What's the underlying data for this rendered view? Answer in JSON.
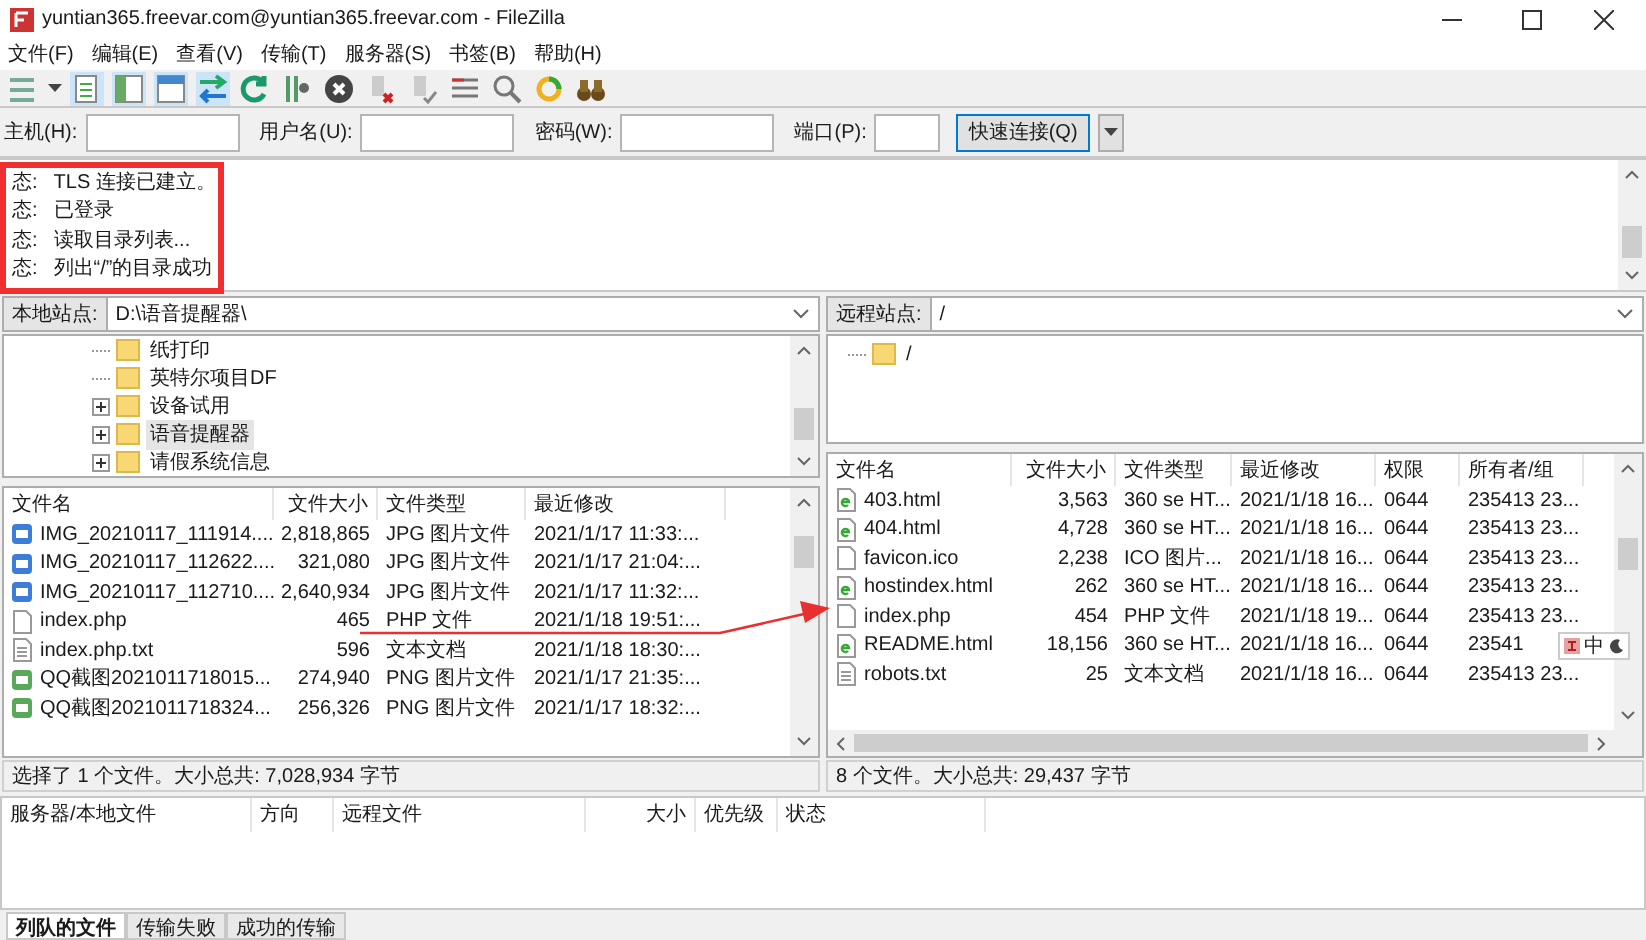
{
  "window": {
    "title": "yuntian365.freevar.com@yuntian365.freevar.com - FileZilla"
  },
  "menu": [
    "文件(F)",
    "编辑(E)",
    "查看(V)",
    "传输(T)",
    "服务器(S)",
    "书签(B)",
    "帮助(H)"
  ],
  "quickconnect": {
    "fields": [
      {
        "label": "主机(H):"
      },
      {
        "label": "用户名(U):"
      },
      {
        "label": "密码(W):"
      },
      {
        "label": "端口(P):"
      }
    ],
    "button": "快速连接(Q)"
  },
  "log": [
    {
      "label": "态:",
      "message": "TLS 连接已建立。"
    },
    {
      "label": "态:",
      "message": "已登录"
    },
    {
      "label": "态:",
      "message": "读取目录列表..."
    },
    {
      "label": "态:",
      "message": "列出“/”的目录成功"
    }
  ],
  "local": {
    "site_label": "本地站点:",
    "path": "D:\\语音提醒器\\",
    "tree": [
      {
        "name": "纸打印",
        "expandable": false,
        "selected": false
      },
      {
        "name": "英特尔项目DF",
        "expandable": false,
        "selected": false
      },
      {
        "name": "设备试用",
        "expandable": true,
        "selected": false
      },
      {
        "name": "语音提醒器",
        "expandable": true,
        "selected": true
      },
      {
        "name": "请假系统信息",
        "expandable": true,
        "selected": false
      }
    ],
    "columns": [
      "文件名",
      "文件大小",
      "文件类型",
      "最近修改"
    ],
    "rows": [
      {
        "kind": "image",
        "name": "IMG_20210117_111914....",
        "size": "2,818,865",
        "type": "JPG 图片文件",
        "modified": "2021/1/17 11:33:..."
      },
      {
        "kind": "image",
        "name": "IMG_20210117_112622....",
        "size": "321,080",
        "type": "JPG 图片文件",
        "modified": "2021/1/17 21:04:..."
      },
      {
        "kind": "image",
        "name": "IMG_20210117_112710....",
        "size": "2,640,934",
        "type": "JPG 图片文件",
        "modified": "2021/1/17 11:32:..."
      },
      {
        "kind": "file",
        "name": "index.php",
        "size": "465",
        "type": "PHP 文件",
        "modified": "2021/1/18 19:51:..."
      },
      {
        "kind": "text",
        "name": "index.php.txt",
        "size": "596",
        "type": "文本文档",
        "modified": "2021/1/18 18:30:..."
      },
      {
        "kind": "png",
        "name": "QQ截图2021011718015...",
        "size": "274,940",
        "type": "PNG 图片文件",
        "modified": "2021/1/17 21:35:..."
      },
      {
        "kind": "png",
        "name": "QQ截图2021011718324...",
        "size": "256,326",
        "type": "PNG 图片文件",
        "modified": "2021/1/17 18:32:..."
      }
    ],
    "status": "选择了 1 个文件。大小总共: 7,028,934 字节"
  },
  "remote": {
    "site_label": "远程站点:",
    "path": "/",
    "tree": [
      {
        "name": "/",
        "expandable": false,
        "selected": false
      }
    ],
    "columns": [
      "文件名",
      "文件大小",
      "文件类型",
      "最近修改",
      "权限",
      "所有者/组"
    ],
    "rows": [
      {
        "kind": "web",
        "name": "403.html",
        "size": "3,563",
        "type": "360 se HT...",
        "modified": "2021/1/18 16...",
        "perms": "0644",
        "owner": "235413 23..."
      },
      {
        "kind": "web",
        "name": "404.html",
        "size": "4,728",
        "type": "360 se HT...",
        "modified": "2021/1/18 16...",
        "perms": "0644",
        "owner": "235413 23..."
      },
      {
        "kind": "file",
        "name": "favicon.ico",
        "size": "2,238",
        "type": "ICO 图片...",
        "modified": "2021/1/18 16...",
        "perms": "0644",
        "owner": "235413 23..."
      },
      {
        "kind": "web",
        "name": "hostindex.html",
        "size": "262",
        "type": "360 se HT...",
        "modified": "2021/1/18 16...",
        "perms": "0644",
        "owner": "235413 23..."
      },
      {
        "kind": "file",
        "name": "index.php",
        "size": "454",
        "type": "PHP 文件",
        "modified": "2021/1/18 19...",
        "perms": "0644",
        "owner": "235413 23..."
      },
      {
        "kind": "web",
        "name": "README.html",
        "size": "18,156",
        "type": "360 se HT...",
        "modified": "2021/1/18 16...",
        "perms": "0644",
        "owner": "23541"
      },
      {
        "kind": "text",
        "name": "robots.txt",
        "size": "25",
        "type": "文本文档",
        "modified": "2021/1/18 16...",
        "perms": "0644",
        "owner": "235413 23..."
      }
    ],
    "status": "8 个文件。大小总共: 29,437 字节"
  },
  "queue": {
    "columns": [
      "服务器/本地文件",
      "方向",
      "远程文件",
      "大小",
      "优先级",
      "状态"
    ]
  },
  "tabs": [
    {
      "label": "列队的文件",
      "selected": true
    },
    {
      "label": "传输失败",
      "selected": false
    },
    {
      "label": "成功的传输",
      "selected": false
    }
  ],
  "ime": {
    "mode": "中"
  }
}
